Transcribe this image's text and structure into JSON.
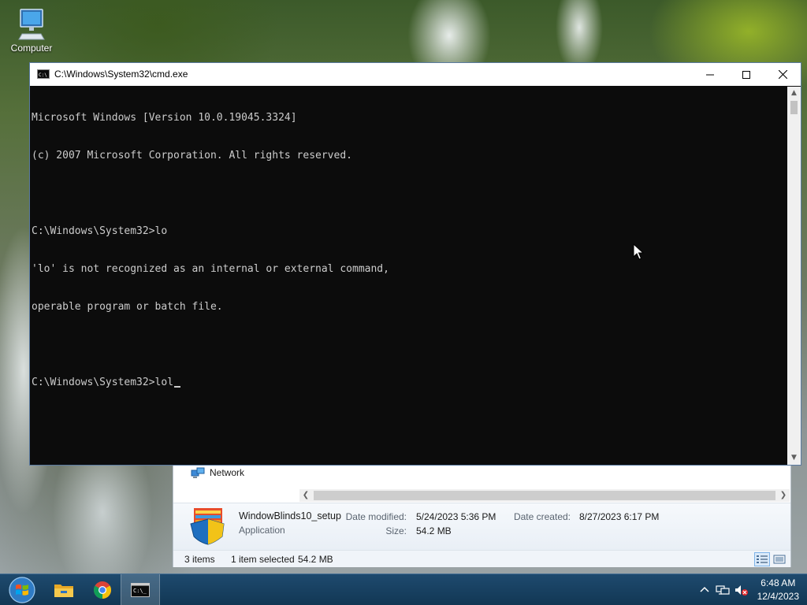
{
  "desktop": {
    "icons": [
      {
        "label": "Computer",
        "icon": "computer-icon"
      }
    ]
  },
  "cmd_window": {
    "title": "C:\\Windows\\System32\\cmd.exe",
    "icon": "cmd-icon",
    "controls": {
      "minimize": "minimize-icon",
      "maximize": "maximize-icon",
      "close": "close-icon"
    },
    "lines": [
      "Microsoft Windows [Version 10.0.19045.3324]",
      "(c) 2007 Microsoft Corporation. All rights reserved.",
      "",
      "C:\\Windows\\System32>lo",
      "'lo' is not recognized as an internal or external command,",
      "operable program or batch file.",
      ""
    ],
    "prompt": "C:\\Windows\\System32>",
    "current_input": "lol",
    "background": "#0c0c0c",
    "text_color": "#cccccc"
  },
  "explorer": {
    "nav_item": {
      "label": "Network",
      "icon": "network-icon"
    },
    "details": {
      "file_name": "WindowBlinds10_setup",
      "file_type": "Application",
      "date_modified_label": "Date modified:",
      "date_modified": "5/24/2023 5:36 PM",
      "date_created_label": "Date created:",
      "date_created": "8/27/2023 6:17 PM",
      "size_label": "Size:",
      "size": "54.2 MB"
    },
    "status": {
      "items": "3 items",
      "selected": "1 item selected",
      "selected_size": "54.2 MB"
    },
    "views": [
      "details-view-icon",
      "preview-view-icon"
    ]
  },
  "taskbar": {
    "start": "windows-start-icon",
    "pinned": [
      "file-explorer-icon",
      "chrome-icon",
      "cmd-icon"
    ],
    "active": "cmd-icon",
    "tray": [
      "show-hidden-icons-chevron",
      "network-icon",
      "volume-muted-icon"
    ],
    "clock": {
      "time": "6:48 AM",
      "date": "12/4/2023"
    },
    "color": "#163e5e"
  }
}
